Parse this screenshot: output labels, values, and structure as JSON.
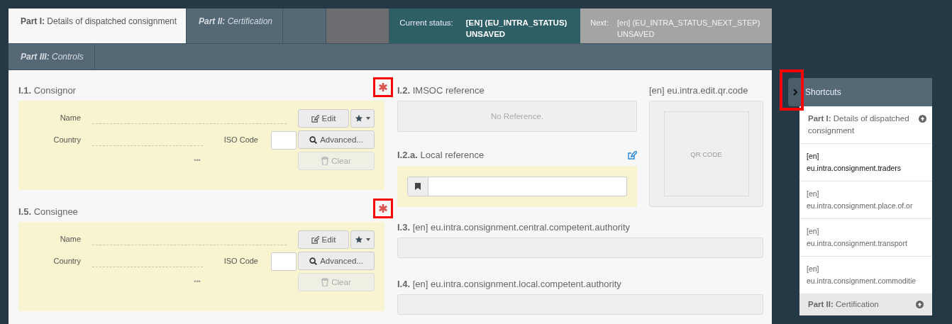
{
  "tab_rows": [
    [
      {
        "label": "**Part I:** Details of dispatched consignment",
        "selected": true
      },
      {
        "label": "**Part II:** Certification",
        "selected": false
      }
    ],
    [
      {
        "label": "**Part III:** Controls",
        "selected": false
      }
    ]
  ],
  "status": {
    "current_label": "Current status:",
    "current_value": "[EN] (EU_INTRA_STATUS) UNSAVED",
    "next_label": "Next:",
    "next_value": "[en] (EU_INTRA_STATUS_NEXT_STEP) UNSAVED"
  },
  "parties": [
    {
      "number": "I.1.",
      "title": "Consignor",
      "required": true,
      "name_label": "Name",
      "country_label": "Country",
      "iso_label": "ISO Code",
      "more": "•••",
      "edit": "Edit",
      "advanced": "Advanced...",
      "clear": "Clear",
      "clear_disabled": true
    },
    {
      "number": "I.5.",
      "title": "Consignee",
      "required": true,
      "name_label": "Name",
      "country_label": "Country",
      "iso_label": "ISO Code",
      "more": "•••",
      "edit": "Edit",
      "advanced": "Advanced...",
      "clear": "Clear",
      "clear_disabled": true
    }
  ],
  "imsoc": {
    "number": "I.2.",
    "title": "IMSOC reference",
    "value": "No Reference."
  },
  "local_reference": {
    "number": "I.2.a.",
    "title": "Local reference"
  },
  "qr": {
    "title": "[en] eu.intra.edit.qr.code",
    "text": "QR CODE"
  },
  "authorities": [
    {
      "number": "I.3.",
      "title": "[en] eu.intra.consignment.central.competent.authority"
    },
    {
      "number": "I.4.",
      "title": "[en] eu.intra.consignment.local.competent.authority"
    }
  ],
  "shortcuts": {
    "title": "Shortcuts",
    "items": [
      {
        "label": "**Part I:** Details of dispatched consignment",
        "expanded": true,
        "children": [
          {
            "label": "[en] eu.intra.consignment.traders",
            "selected": true
          },
          {
            "label": "[en] eu.intra.consignment.place.of.or",
            "selected": false
          },
          {
            "label": "[en] eu.intra.consignment.transport",
            "selected": false
          },
          {
            "label": "[en] eu.intra.consignment.commoditie",
            "selected": false
          }
        ]
      },
      {
        "label": "**Part II:** Certification",
        "expanded": false
      }
    ]
  }
}
